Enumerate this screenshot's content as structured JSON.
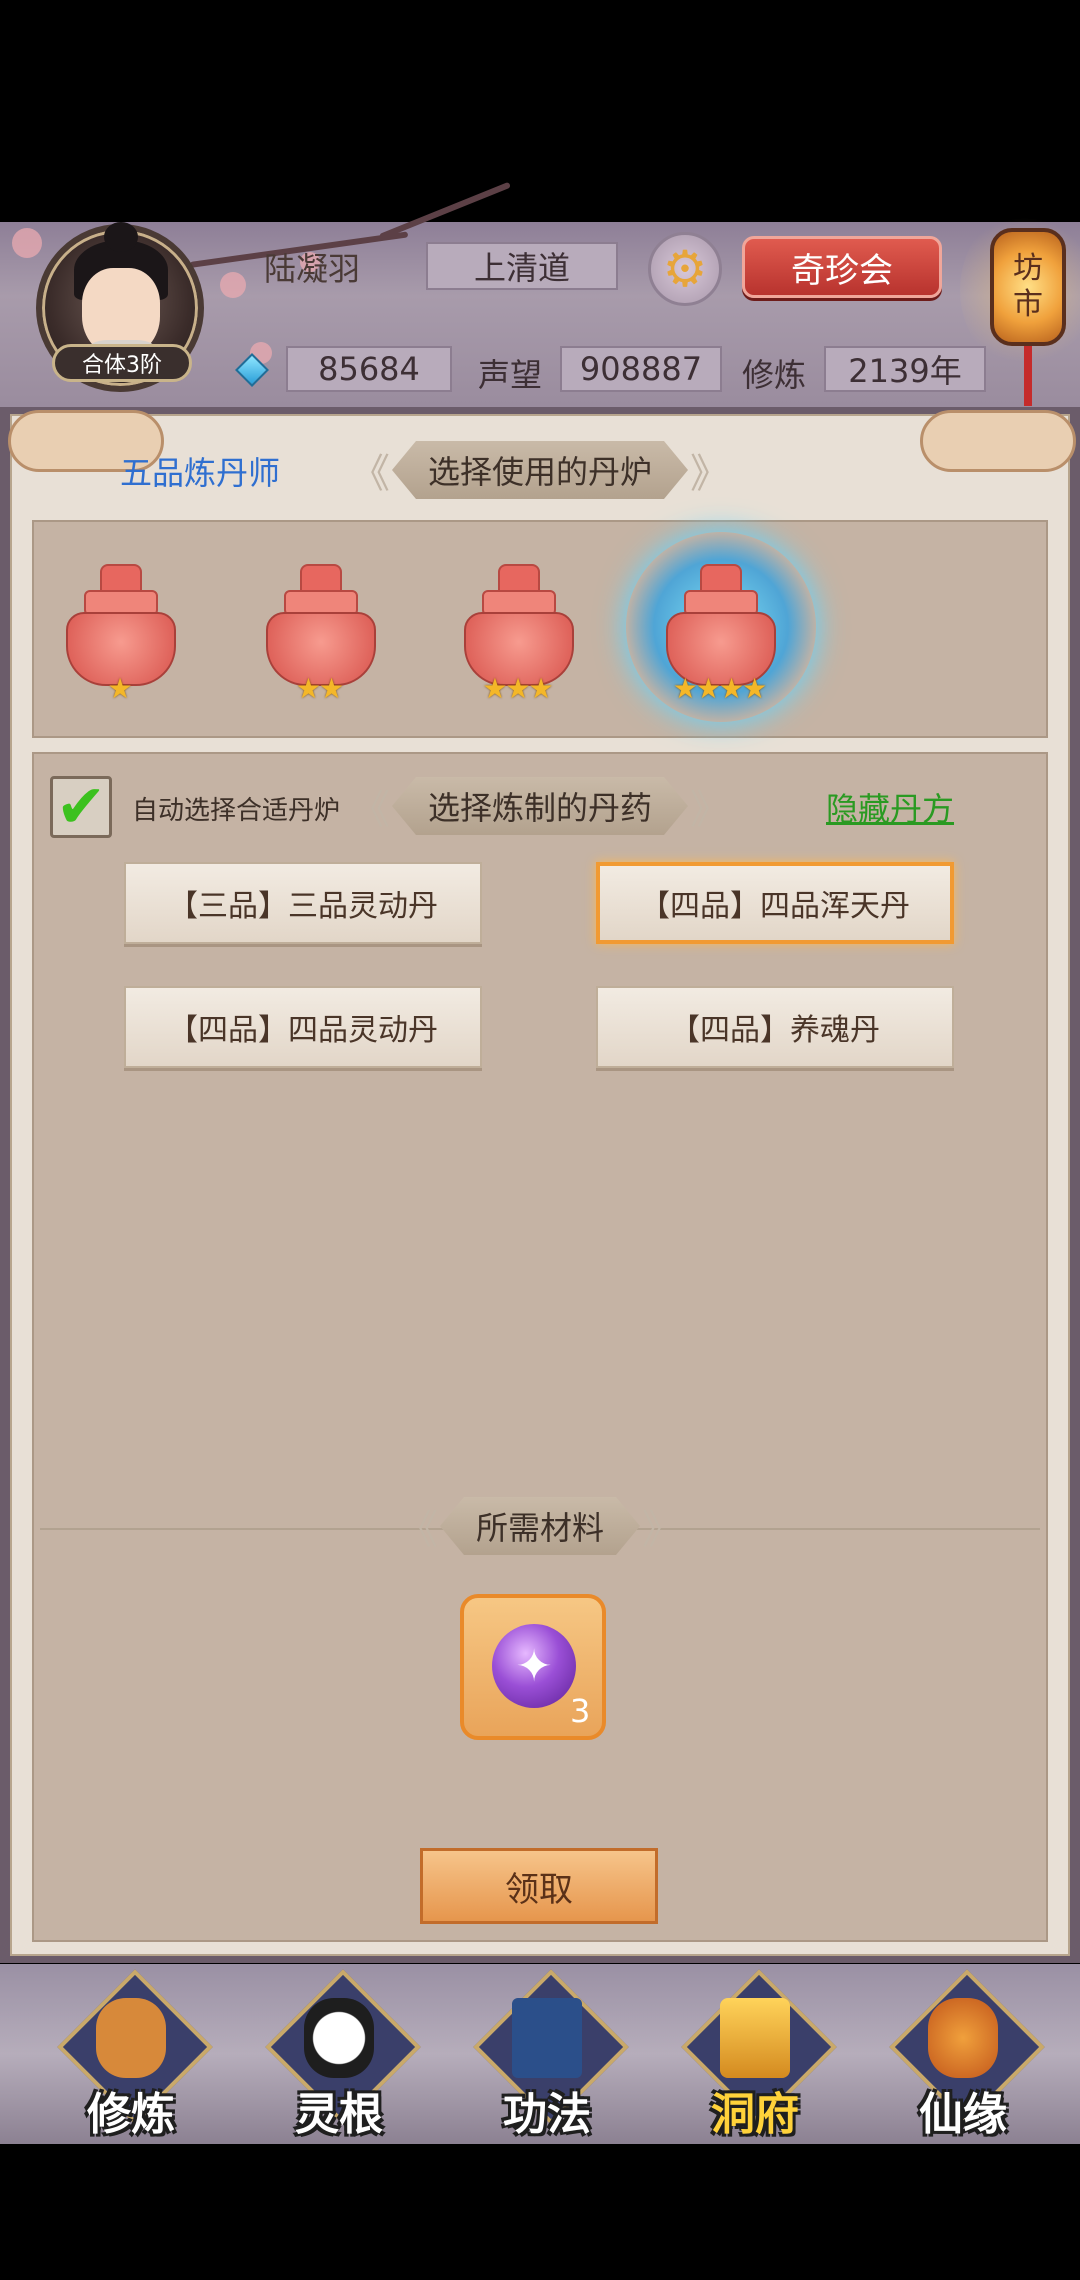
{
  "player": {
    "name": "陆凝羽",
    "realm": "合体3阶",
    "sect": "上清道",
    "spirit_stones": "85684",
    "prestige_label": "声望",
    "prestige": "908887",
    "cultivation_label": "修炼",
    "cultivation": "2139年"
  },
  "header": {
    "treasure_button": "奇珍会",
    "market_line1": "坊",
    "market_line2": "市",
    "gear_glyph": "⚙"
  },
  "alchemy": {
    "rank": "五品炼丹师",
    "furnace_title": "选择使用的丹炉",
    "furnaces": [
      {
        "stars": "★"
      },
      {
        "stars": "★★"
      },
      {
        "stars": "★★★"
      },
      {
        "stars": "★★★★"
      }
    ],
    "auto_select_label": "自动选择合适丹炉",
    "auto_select_checked": "✔",
    "pill_title": "选择炼制的丹药",
    "hide_recipes": "隐藏丹方",
    "pills": [
      {
        "label": "【三品】三品灵动丹"
      },
      {
        "label": "【四品】四品浑天丹",
        "selected": true
      },
      {
        "label": "【四品】四品灵动丹"
      },
      {
        "label": "【四品】养魂丹"
      }
    ],
    "materials_title": "所需材料",
    "material": {
      "icon": "purple-spirit-orb-icon",
      "count": "3"
    },
    "claim_button": "领取"
  },
  "bottom_nav": [
    {
      "label": "修炼",
      "icon": "meditating-monk-icon"
    },
    {
      "label": "灵根",
      "icon": "yin-yang-sword-icon"
    },
    {
      "label": "功法",
      "icon": "technique-book-icon"
    },
    {
      "label": "洞府",
      "icon": "cave-mansion-icon",
      "active": true
    },
    {
      "label": "仙缘",
      "icon": "gourd-icon"
    }
  ],
  "colors": {
    "accent_orange": "#f19a32",
    "rank_blue": "#2f6fd0",
    "link_green": "#2a9a22",
    "nav_active_yellow": "#ffd23a"
  }
}
